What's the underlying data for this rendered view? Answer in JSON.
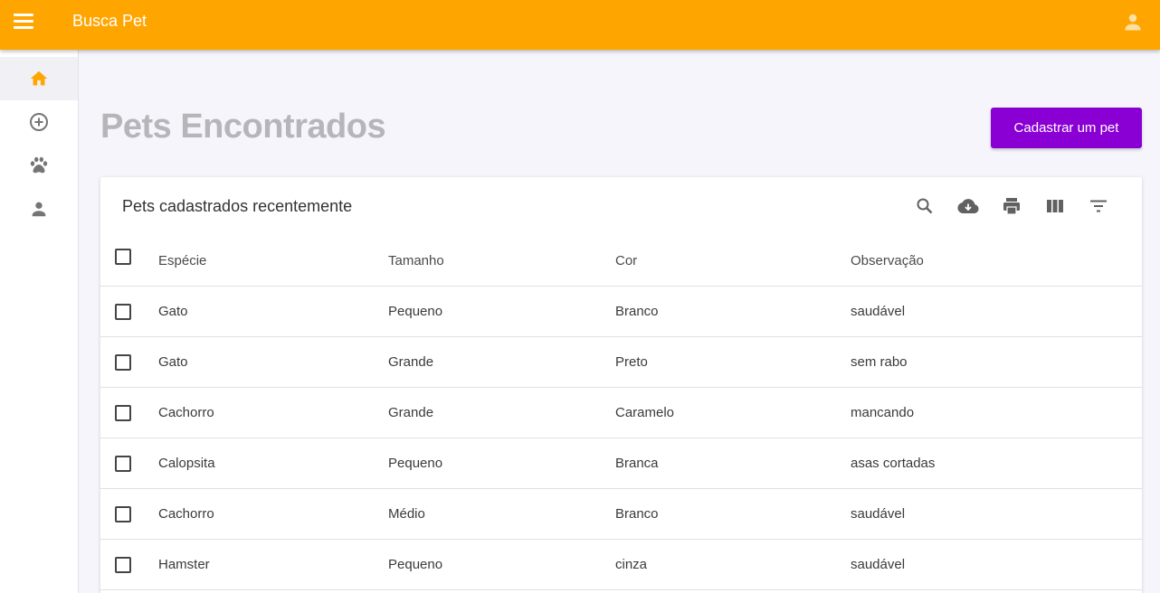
{
  "app": {
    "title": "Busca Pet"
  },
  "colors": {
    "appbar": "#ffa500",
    "accent": "#8a00d4",
    "active_icon": "#ffa500",
    "icon": "#757575"
  },
  "sidebar": {
    "items": [
      {
        "icon": "home-icon"
      },
      {
        "icon": "add-circle-icon"
      },
      {
        "icon": "paw-icon"
      },
      {
        "icon": "person-icon"
      }
    ]
  },
  "page": {
    "title": "Pets Encontrados",
    "cta_label": "Cadastrar um pet"
  },
  "table": {
    "title": "Pets cadastrados recentemente",
    "toolbar_icons": [
      "search-icon",
      "download-icon",
      "print-icon",
      "columns-icon",
      "filter-icon"
    ],
    "columns": [
      "Espécie",
      "Tamanho",
      "Cor",
      "Observação"
    ],
    "rows": [
      [
        "Gato",
        "Pequeno",
        "Branco",
        "saudável"
      ],
      [
        "Gato",
        "Grande",
        "Preto",
        "sem rabo"
      ],
      [
        "Cachorro",
        "Grande",
        "Caramelo",
        "mancando"
      ],
      [
        "Calopsita",
        "Pequeno",
        "Branca",
        "asas cortadas"
      ],
      [
        "Cachorro",
        "Médio",
        "Branco",
        "saudável"
      ],
      [
        "Hamster",
        "Pequeno",
        "cinza",
        "saudável"
      ]
    ]
  }
}
